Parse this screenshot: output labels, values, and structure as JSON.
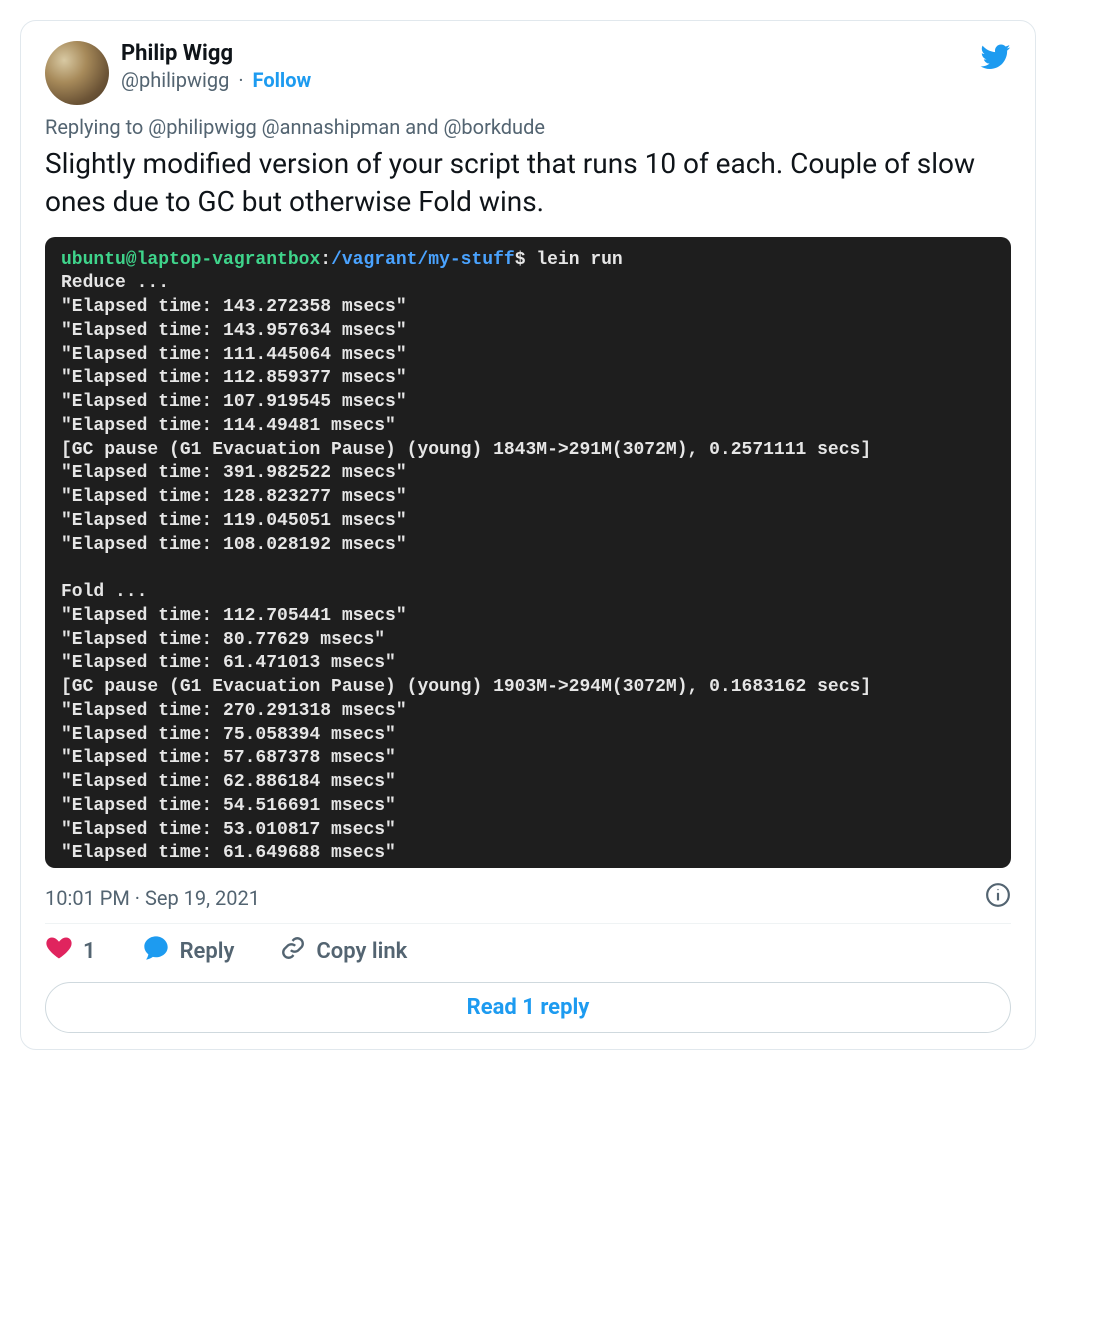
{
  "user": {
    "display_name": "Philip Wigg",
    "handle": "@philipwigg",
    "follow_label": "Follow"
  },
  "reply_to": "Replying to @philipwigg @annashipman and @borkdude",
  "tweet_text": "Slightly modified version of your script that runs 10 of each. Couple of slow ones due to GC but otherwise Fold wins.",
  "terminal": {
    "prompt_user": "ubuntu@laptop-vagrantbox",
    "prompt_sep": ":",
    "prompt_path": "/vagrant/my-stuff",
    "prompt_dollar": "$",
    "command": " lein run",
    "lines": [
      "Reduce ...",
      "\"Elapsed time: 143.272358 msecs\"",
      "\"Elapsed time: 143.957634 msecs\"",
      "\"Elapsed time: 111.445064 msecs\"",
      "\"Elapsed time: 112.859377 msecs\"",
      "\"Elapsed time: 107.919545 msecs\"",
      "\"Elapsed time: 114.49481 msecs\"",
      "[GC pause (G1 Evacuation Pause) (young) 1843M->291M(3072M), 0.2571111 secs]",
      "\"Elapsed time: 391.982522 msecs\"",
      "\"Elapsed time: 128.823277 msecs\"",
      "\"Elapsed time: 119.045051 msecs\"",
      "\"Elapsed time: 108.028192 msecs\"",
      "",
      "Fold ...",
      "\"Elapsed time: 112.705441 msecs\"",
      "\"Elapsed time: 80.77629 msecs\"",
      "\"Elapsed time: 61.471013 msecs\"",
      "[GC pause (G1 Evacuation Pause) (young) 1903M->294M(3072M), 0.1683162 secs]",
      "\"Elapsed time: 270.291318 msecs\"",
      "\"Elapsed time: 75.058394 msecs\"",
      "\"Elapsed time: 57.687378 msecs\"",
      "\"Elapsed time: 62.886184 msecs\"",
      "\"Elapsed time: 54.516691 msecs\"",
      "\"Elapsed time: 53.010817 msecs\"",
      "\"Elapsed time: 61.649688 msecs\""
    ]
  },
  "timestamp": "10:01 PM · Sep 19, 2021",
  "actions": {
    "like_count": "1",
    "reply_label": "Reply",
    "copy_label": "Copy link"
  },
  "read_replies": "Read 1 reply"
}
